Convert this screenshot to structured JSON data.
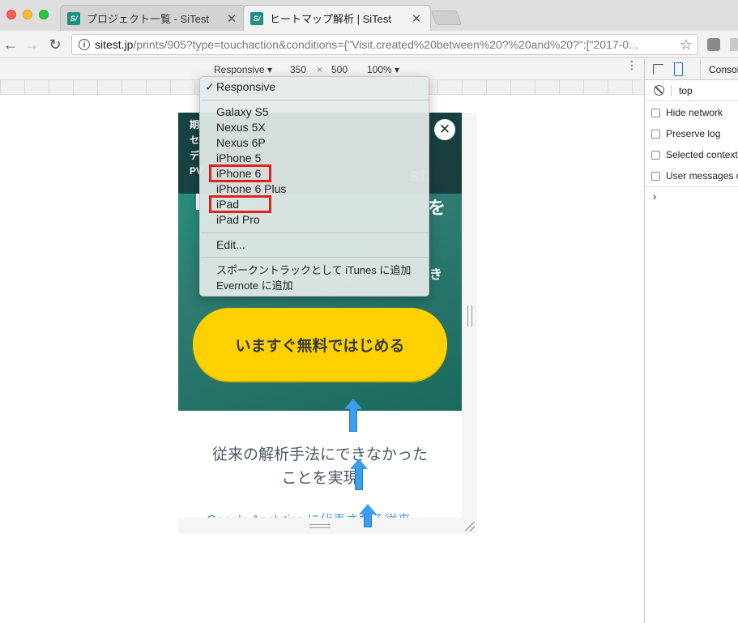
{
  "browser": {
    "tabs": [
      {
        "title": "プロジェクト一覧 - SiTest",
        "favicon": "sitest-favicon",
        "active": false
      },
      {
        "title": "ヒートマップ解析 | SiTest",
        "favicon": "sitest-favicon",
        "active": true
      }
    ],
    "favicon_text": "S/",
    "tab_close_glyph": "✕",
    "url_host": "sitest.jp",
    "url_rest": "/prints/905?type=touchaction&conditions={\"Visit.created%20between%20?%20and%20?\":[\"2017-0..."
  },
  "device_toolbar": {
    "device": "Responsive",
    "width": "350",
    "times": "×",
    "height": "500",
    "zoom": "100%"
  },
  "dropdown": {
    "selected": "Responsive",
    "check": "✓",
    "devices": [
      "Galaxy S5",
      "Nexus 5X",
      "Nexus 6P",
      "iPhone 5",
      "iPhone 6",
      "iPhone 6 Plus",
      "iPad",
      "iPad Pro"
    ],
    "edit": "Edit...",
    "itunes": "スポークントラックとして iTunes に追加",
    "evernote": "Evernote に追加",
    "highlighted": [
      "iPhone 6",
      "iPad"
    ],
    "highlight_color": "#e0221b"
  },
  "page": {
    "hero_left_lines": [
      "期",
      "セ",
      "デ",
      "PV"
    ],
    "close_glyph": "✕",
    "logo_ghost": "st",
    "hero_o": "を",
    "hero_ki": "き",
    "cta_label": "いますぐ無料ではじめる",
    "cta_color": "#ffd100",
    "body_line1": "従来の解析手法にできなかった",
    "body_line2": "ことを実現",
    "link_text": "Google Analytics に代表される従来",
    "arrow_color": "#3d9ef0"
  },
  "devtools": {
    "console_tab": "Console",
    "context": "top",
    "options": [
      "Hide network",
      "Preserve log",
      "Selected context only",
      "User messages only"
    ],
    "prompt": "›"
  }
}
